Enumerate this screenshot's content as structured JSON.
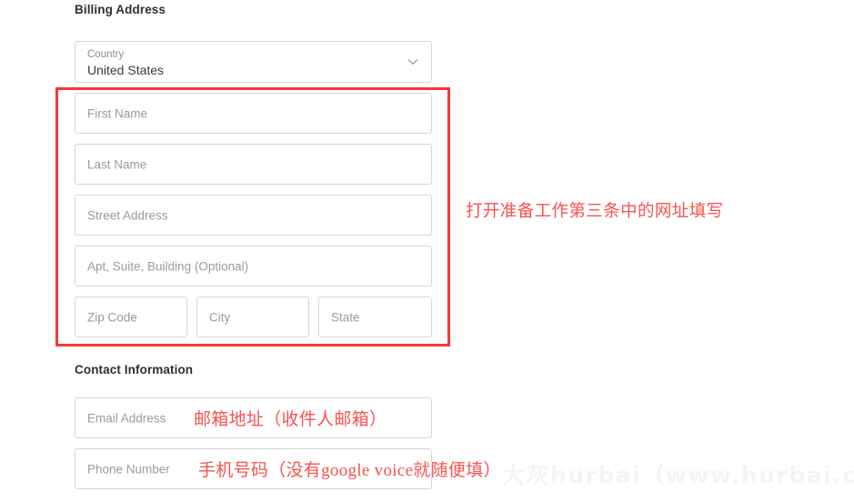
{
  "billing": {
    "heading": "Billing Address",
    "country": {
      "label": "Country",
      "value": "United States",
      "icon": "chevron-down-icon"
    },
    "fields": {
      "first_name_placeholder": "First Name",
      "last_name_placeholder": "Last Name",
      "street_placeholder": "Street Address",
      "apt_placeholder": "Apt, Suite, Building (Optional)",
      "zip_placeholder": "Zip Code",
      "city_placeholder": "City",
      "state_placeholder": "State"
    }
  },
  "contact": {
    "heading": "Contact Information",
    "fields": {
      "email_placeholder": "Email Address",
      "phone_placeholder": "Phone Number"
    }
  },
  "annotations": {
    "url_note": "打开准备工作第三条中的网址填写",
    "email_note": "邮箱地址（收件人邮箱）",
    "phone_note": "手机号码（没有google voice就随便填）",
    "highlight_color": "#f43a38",
    "text_color": "#f6534f"
  },
  "watermark": {
    "text": "大灰hurbai（www.hurbai.com）"
  }
}
